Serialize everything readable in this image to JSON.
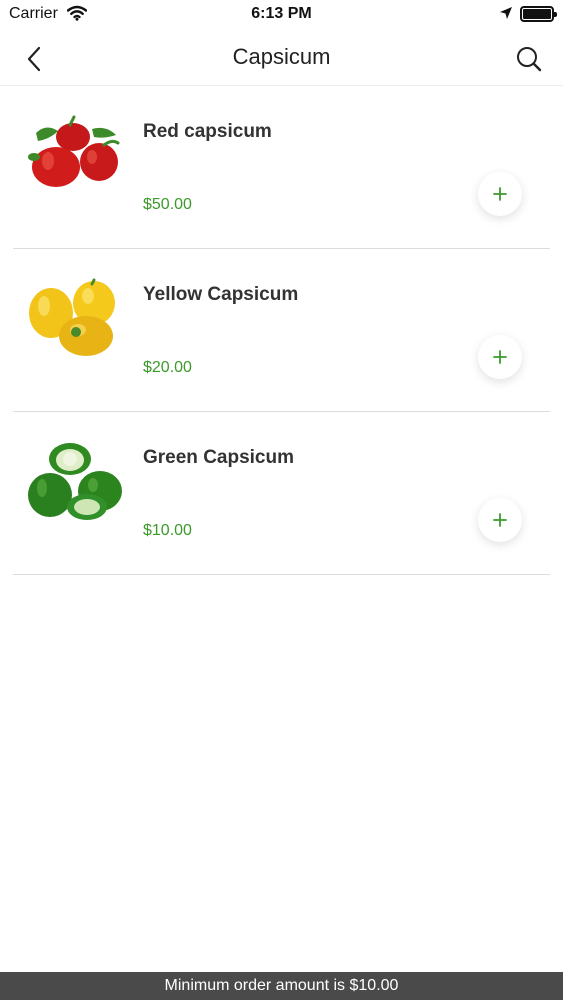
{
  "status_bar": {
    "carrier": "Carrier",
    "time": "6:13 PM",
    "icons": [
      "wifi-icon",
      "location-arrow-icon",
      "battery-icon"
    ]
  },
  "nav": {
    "title": "Capsicum",
    "back_icon": "chevron-left-icon",
    "search_icon": "search-icon"
  },
  "products": [
    {
      "name": "Red capsicum",
      "price": "$50.00",
      "image": "red-capsicum-image",
      "add_label": "+"
    },
    {
      "name": "Yellow Capsicum",
      "price": "$20.00",
      "image": "yellow-capsicum-image",
      "add_label": "+"
    },
    {
      "name": "Green Capsicum",
      "price": "$10.00",
      "image": "green-capsicum-image",
      "add_label": "+"
    }
  ],
  "footer": {
    "message": "Minimum order amount is $10.00"
  },
  "colors": {
    "price": "#3a9a2a",
    "add_icon": "#3a9a2a",
    "footer_background": "#4a4a4a",
    "divider": "#dcdcdc"
  }
}
